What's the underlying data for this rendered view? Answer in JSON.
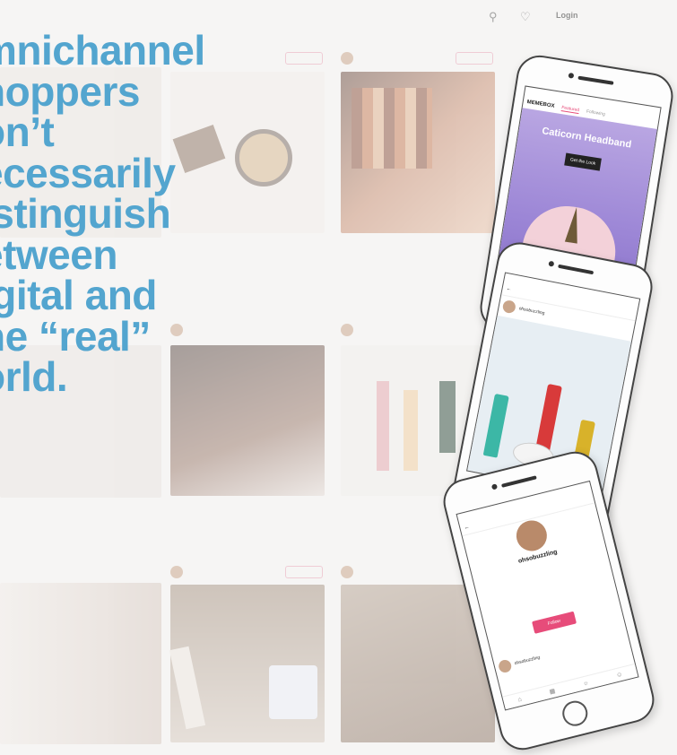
{
  "headline": "mnichannel\nhoppers\non’t\necessarily\nistinguish\netween\nigital and\nhe “real”\norld.",
  "topbar": {
    "login_label": "Login"
  },
  "icons": {
    "search": "search-icon",
    "heart": "heart-icon"
  },
  "colors": {
    "headline": "#53a5cf",
    "accent": "#e74c7a",
    "promo": "#9c86d6"
  },
  "phones": {
    "promo": {
      "logo": "MEMEBOX",
      "tab_featured": "Featured",
      "tab_following": "Following",
      "title": "Caticorn Headband",
      "cta": "Get the Look"
    },
    "product": {
      "username": "ohsobuzzling"
    },
    "profile": {
      "name": "ohsobuzzling",
      "follow_cta": "Follow",
      "post_username": "ohsobuzzling"
    }
  }
}
